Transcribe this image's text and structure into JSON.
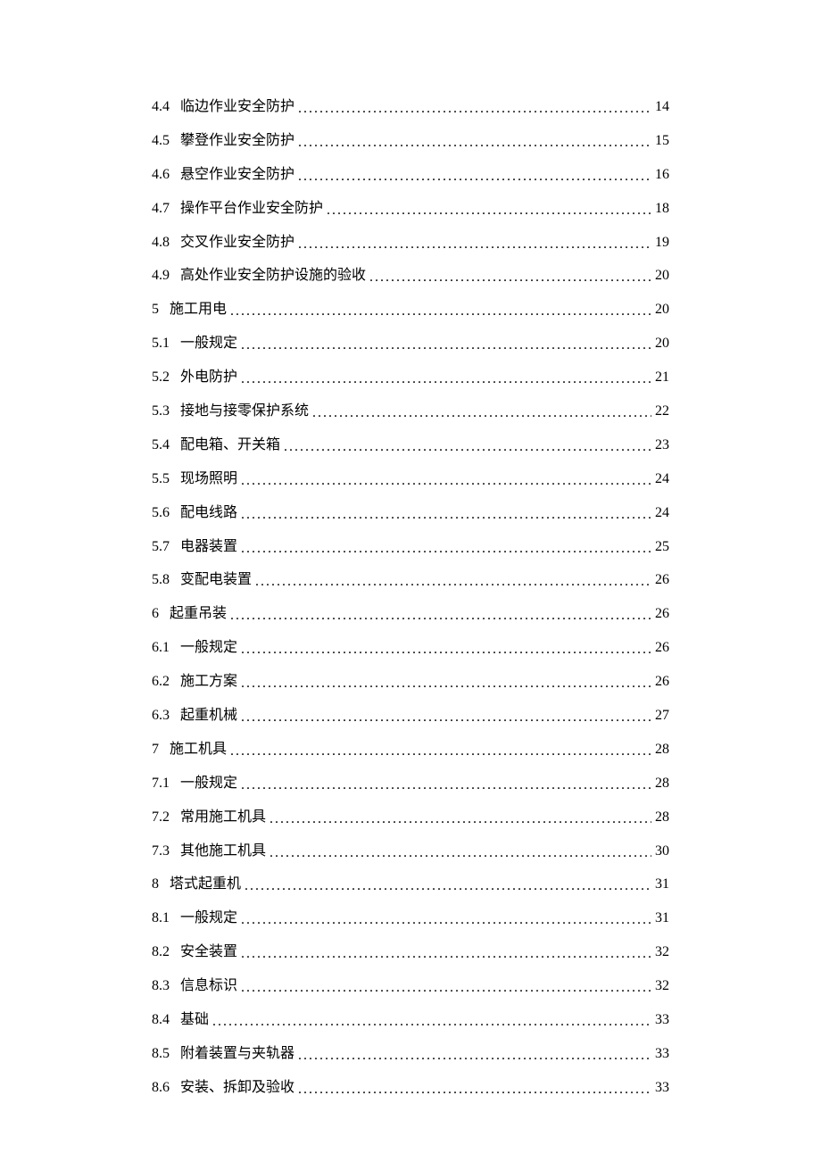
{
  "toc": [
    {
      "num": "4.4",
      "title": "临边作业安全防护",
      "page": "14",
      "level": 2
    },
    {
      "num": "4.5",
      "title": "攀登作业安全防护",
      "page": "15",
      "level": 2
    },
    {
      "num": "4.6",
      "title": "悬空作业安全防护",
      "page": "16",
      "level": 2
    },
    {
      "num": "4.7",
      "title": "操作平台作业安全防护",
      "page": "18",
      "level": 2
    },
    {
      "num": "4.8",
      "title": "交叉作业安全防护",
      "page": "19",
      "level": 2
    },
    {
      "num": "4.9",
      "title": "高处作业安全防护设施的验收",
      "page": "20",
      "level": 2
    },
    {
      "num": "5",
      "title": "施工用电",
      "page": "20",
      "level": 1
    },
    {
      "num": "5.1",
      "title": "一般规定",
      "page": "20",
      "level": 2
    },
    {
      "num": "5.2",
      "title": "外电防护",
      "page": "21",
      "level": 2
    },
    {
      "num": "5.3",
      "title": "接地与接零保护系统",
      "page": "22",
      "level": 2
    },
    {
      "num": "5.4",
      "title": "配电箱、开关箱",
      "page": "23",
      "level": 2
    },
    {
      "num": "5.5",
      "title": "现场照明",
      "page": "24",
      "level": 2
    },
    {
      "num": "5.6",
      "title": "配电线路",
      "page": "24",
      "level": 2
    },
    {
      "num": "5.7",
      "title": "电器装置",
      "page": "25",
      "level": 2
    },
    {
      "num": "5.8",
      "title": "变配电装置",
      "page": "26",
      "level": 2
    },
    {
      "num": "6",
      "title": "起重吊装",
      "page": "26",
      "level": 1
    },
    {
      "num": "6.1",
      "title": "一般规定",
      "page": "26",
      "level": 2
    },
    {
      "num": "6.2",
      "title": "施工方案",
      "page": "26",
      "level": 2
    },
    {
      "num": "6.3",
      "title": "起重机械",
      "page": "27",
      "level": 2
    },
    {
      "num": "7",
      "title": "施工机具",
      "page": "28",
      "level": 1
    },
    {
      "num": "7.1",
      "title": "一般规定",
      "page": "28",
      "level": 2
    },
    {
      "num": "7.2",
      "title": "常用施工机具",
      "page": "28",
      "level": 2
    },
    {
      "num": "7.3",
      "title": "其他施工机具",
      "page": "30",
      "level": 2
    },
    {
      "num": "8",
      "title": "塔式起重机",
      "page": "31",
      "level": 1
    },
    {
      "num": "8.1",
      "title": "一般规定",
      "page": "31",
      "level": 2
    },
    {
      "num": "8.2",
      "title": "安全装置",
      "page": "32",
      "level": 2
    },
    {
      "num": "8.3",
      "title": "信息标识",
      "page": "32",
      "level": 2
    },
    {
      "num": "8.4",
      "title": "基础",
      "page": "33",
      "level": 2
    },
    {
      "num": "8.5",
      "title": "附着装置与夹轨器",
      "page": "33",
      "level": 2
    },
    {
      "num": "8.6",
      "title": "安装、拆卸及验收",
      "page": "33",
      "level": 2
    }
  ]
}
